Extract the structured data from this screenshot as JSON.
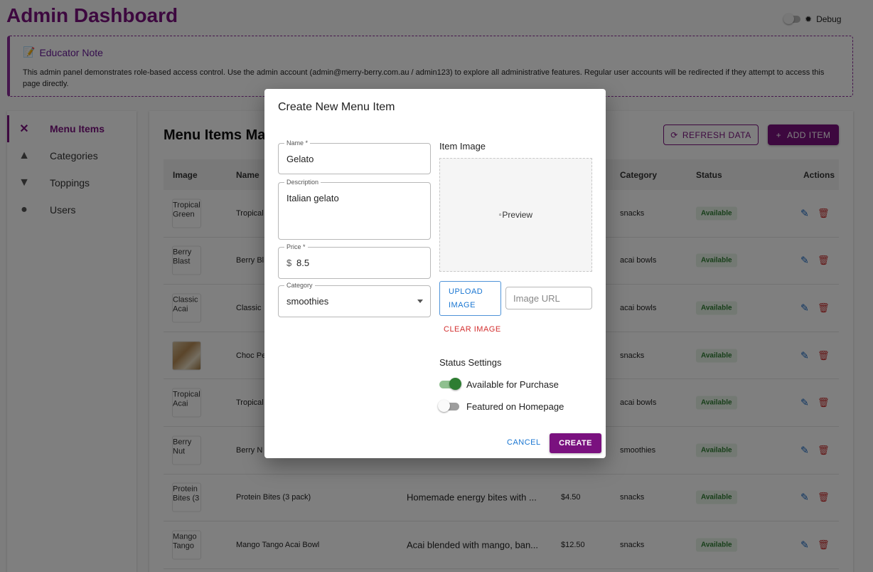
{
  "header": {
    "title": "Admin Dashboard",
    "debug_label": "Debug",
    "debug_on": false
  },
  "note": {
    "title": "Educator Note",
    "text": "This admin panel demonstrates role-based access control. Use the admin account (admin@merry-berry.com.au / admin123) to explore all administrative features. Regular user accounts will be redirected if they attempt to access this page directly."
  },
  "sidebar": {
    "items": [
      {
        "label": "Menu Items",
        "icon": "utensils-icon",
        "active": true
      },
      {
        "label": "Categories",
        "icon": "shapes-icon",
        "active": false
      },
      {
        "label": "Toppings",
        "icon": "cherry-icon",
        "active": false
      },
      {
        "label": "Users",
        "icon": "people-icon",
        "active": false
      }
    ]
  },
  "main": {
    "title": "Menu Items Mar",
    "refresh_label": "REFRESH DATA",
    "add_label": "ADD ITEM",
    "columns": {
      "image": "Image",
      "name": "Name",
      "category": "Category",
      "status": "Status",
      "actions": "Actions"
    },
    "rows": [
      {
        "thumb": "Tropical Green",
        "name": "Tropical",
        "description": "",
        "price": "",
        "category": "snacks",
        "status": "Available",
        "photo": false
      },
      {
        "thumb": "Berry Blast",
        "name": "Berry Bl",
        "description": "",
        "price": "",
        "category": "acai bowls",
        "status": "Available",
        "photo": false
      },
      {
        "thumb": "Classic Acai",
        "name": "Classic",
        "description": "",
        "price": "",
        "category": "acai bowls",
        "status": "Available",
        "photo": false
      },
      {
        "thumb": "",
        "name": "Choc Pe",
        "description": "",
        "price": "",
        "category": "snacks",
        "status": "Available",
        "photo": true
      },
      {
        "thumb": "Tropical Acai",
        "name": "Tropical",
        "description": "",
        "price": "",
        "category": "acai bowls",
        "status": "Available",
        "photo": false
      },
      {
        "thumb": "Berry Nut",
        "name": "Berry N",
        "description": "",
        "price": "",
        "category": "smoothies",
        "status": "Available",
        "photo": false
      },
      {
        "thumb": "Protein Bites (3",
        "name": "Protein Bites (3 pack)",
        "description": "Homemade energy bites with ...",
        "price": "$4.50",
        "category": "snacks",
        "status": "Available",
        "photo": false
      },
      {
        "thumb": "Mango Tango",
        "name": "Mango Tango Acai Bowl",
        "description": "Acai blended with mango, ban...",
        "price": "$12.50",
        "category": "snacks",
        "status": "Available",
        "photo": false
      }
    ]
  },
  "dialog": {
    "title": "Create New Menu Item",
    "name_label": "Name *",
    "name_value": "Gelato",
    "description_label": "Description",
    "description_value": "Italian gelato",
    "price_label": "Price *",
    "price_prefix": "$",
    "price_value": "8.5",
    "category_label": "Category",
    "category_value": "smoothies",
    "image_label": "Item Image",
    "preview_alt": "Preview",
    "upload_label": "UPLOAD IMAGE",
    "url_placeholder": "Image URL",
    "clear_label": "CLEAR IMAGE",
    "status_title": "Status Settings",
    "available_label": "Available for Purchase",
    "available_on": true,
    "featured_label": "Featured on Homepage",
    "featured_on": false,
    "cancel_label": "CANCEL",
    "create_label": "CREATE"
  },
  "colors": {
    "brand": "#7a117f",
    "link": "#1976d2",
    "danger": "#d32f2f",
    "success": "#2e7d32"
  }
}
